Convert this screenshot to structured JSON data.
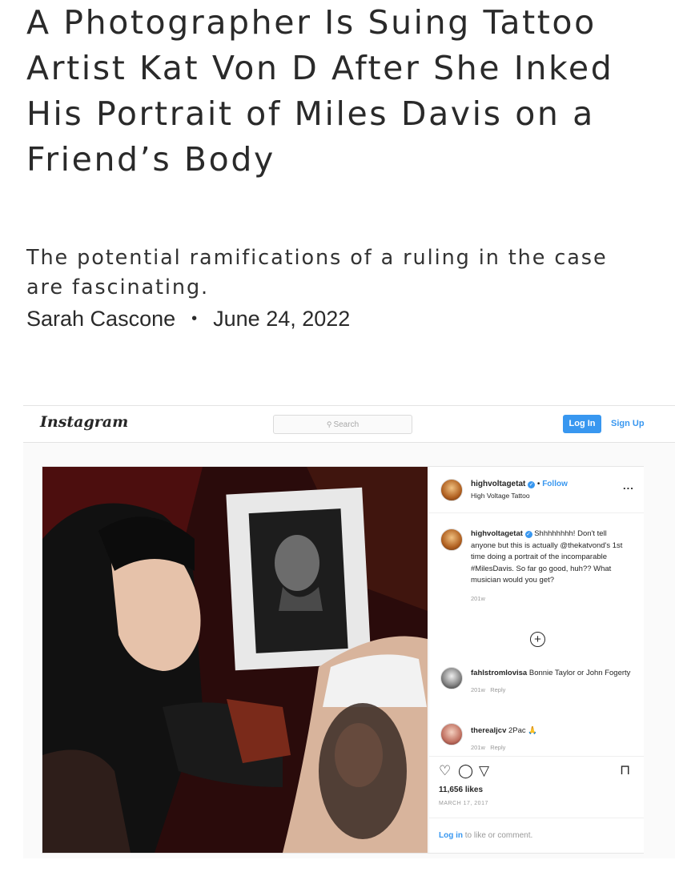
{
  "article": {
    "headline": "A Photographer Is Suing Tattoo Artist Kat Von D After She Inked His Portrait of Miles Davis on a Friend’s Body",
    "dek": "The potential ramifications of a ruling in the case are fascinating.",
    "author": "Sarah Cascone",
    "separator": "•",
    "date": "June 24, 2022"
  },
  "instagram": {
    "logo": "Instagram",
    "search_placeholder": "Search",
    "login_label": "Log In",
    "signup_label": "Sign Up",
    "post": {
      "username": "highvoltagetat",
      "follow_label": "Follow",
      "follow_separator": "•",
      "display_name": "High Voltage Tattoo",
      "more_label": "...",
      "caption_text": "Shhhhhhhh! Don't tell anyone but this is actually @thekatvond's 1st time doing a portrait of the incomparable #MilesDavis. So far go good, huh?? What musician would you get?",
      "caption_time": "201w",
      "load_more": "+",
      "comments": [
        {
          "user": "fahlstromlovisa",
          "text": "Bonnie Taylor or John Fogerty",
          "time": "201w",
          "reply": "Reply"
        },
        {
          "user": "therealjcv",
          "text": "2Pac 🙏",
          "time": "201w",
          "reply": "Reply"
        }
      ],
      "likes": "11,656 likes",
      "date": "MARCH 17, 2017",
      "login_link": "Log in",
      "login_suffix": "to like or comment."
    },
    "icons": [
      "heart-icon",
      "comment-icon",
      "share-icon",
      "bookmark-icon",
      "search-icon",
      "plus-circle-icon"
    ]
  }
}
